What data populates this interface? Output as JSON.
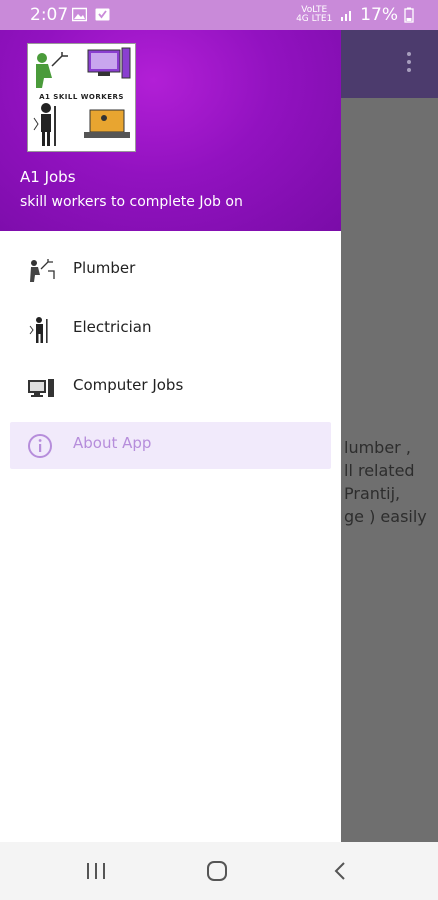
{
  "status_bar": {
    "time": "2:07",
    "network": "VoLTE 4G LTE1",
    "battery_percent": "17%"
  },
  "drawer": {
    "logo_text": "A1 SKILL WORKERS",
    "title": "A1 Jobs",
    "subtitle": "skill workers to complete Job on",
    "items": [
      {
        "label": "Plumber",
        "icon": "plumber-icon"
      },
      {
        "label": "Electrician",
        "icon": "electrician-icon"
      },
      {
        "label": "Computer Jobs",
        "icon": "computer-icon"
      },
      {
        "label": "About App",
        "icon": "info-icon"
      }
    ]
  },
  "background": {
    "lines": [
      "lumber ,",
      "ll related",
      "Prantij,",
      "ge ) easily"
    ]
  },
  "colors": {
    "status_bar": "#c98ad9",
    "drawer_header": "#9212c0",
    "active_item_bg": "#f1eafb",
    "active_item_text": "#b68ddb",
    "overlay": "#6f6f6f"
  }
}
